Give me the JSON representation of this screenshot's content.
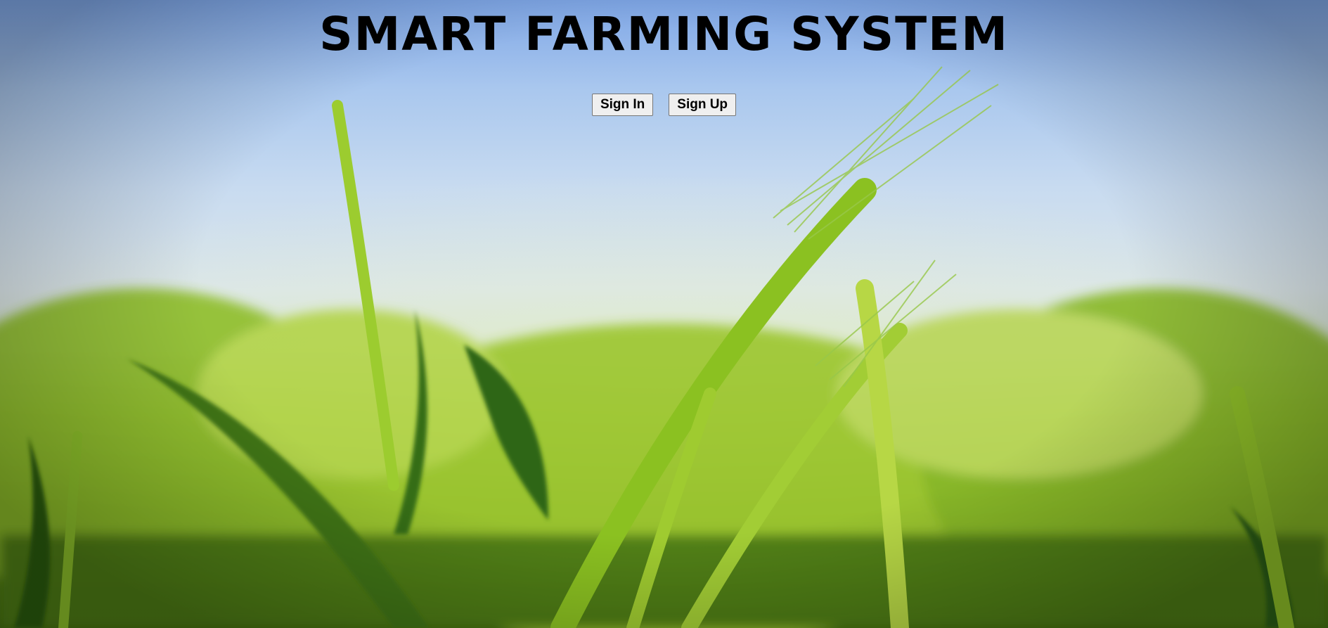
{
  "page": {
    "title": "SMART FARMING SYSTEM"
  },
  "auth": {
    "sign_in_label": "Sign In",
    "sign_up_label": "Sign Up"
  },
  "background": {
    "image": "wheat-field-photo",
    "sky_color": "#a9c7ee",
    "field_color": "#6f9e1d"
  }
}
